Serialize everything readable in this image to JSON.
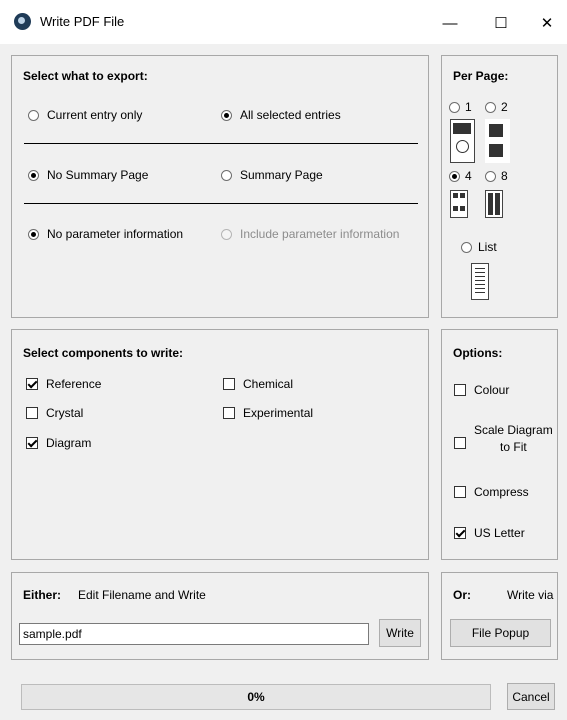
{
  "window": {
    "title": "Write PDF File",
    "minimize": "—",
    "maximize": "☐",
    "close": "✕"
  },
  "export": {
    "title": "Select what to export:",
    "current_entry": "Current entry only",
    "all_selected": "All selected entries",
    "no_summary": "No Summary Page",
    "summary": "Summary Page",
    "no_param": "No parameter information",
    "include_param": "Include parameter information"
  },
  "per_page": {
    "title": "Per Page:",
    "one": "1",
    "two": "2",
    "four": "4",
    "eight": "8",
    "list": "List",
    "selected": "4"
  },
  "components": {
    "title": "Select components to write:",
    "reference": "Reference",
    "chemical": "Chemical",
    "crystal": "Crystal",
    "experimental": "Experimental",
    "diagram": "Diagram"
  },
  "options": {
    "title": "Options:",
    "colour": "Colour",
    "scale_line1": "Scale Diagram",
    "scale_line2": "to Fit",
    "compress": "Compress",
    "us_letter": "US Letter"
  },
  "either": {
    "label": "Either:",
    "text": "Edit Filename and Write",
    "filename": "sample.pdf",
    "write_button": "Write"
  },
  "or": {
    "label": "Or:",
    "text": "Write via",
    "file_popup_button": "File Popup"
  },
  "footer": {
    "progress_text": "0%",
    "progress_value": 0,
    "cancel_button": "Cancel"
  },
  "icons": [
    "app-icon",
    "minimize-icon",
    "maximize-icon",
    "close-icon"
  ]
}
